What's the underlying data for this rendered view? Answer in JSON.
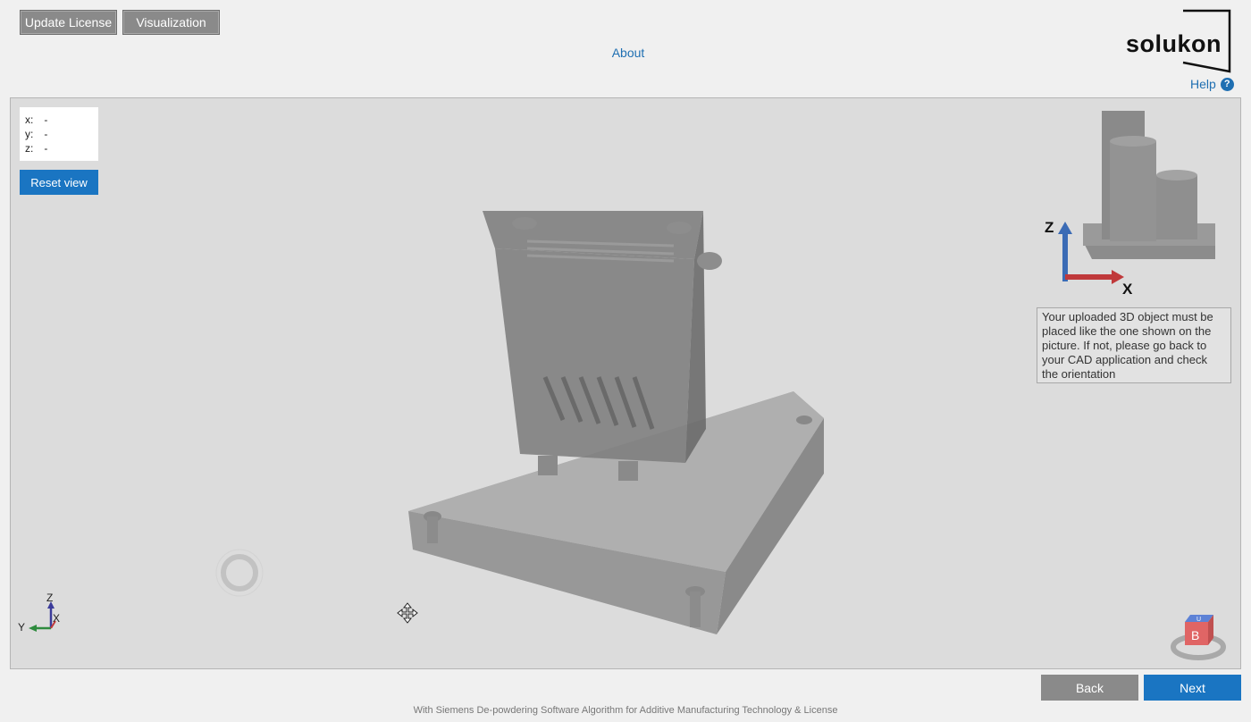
{
  "toolbar": {
    "update_license_label": "Update License",
    "visualization_label": "Visualization",
    "about_label": "About"
  },
  "brand": {
    "logo_text": "solukon",
    "help_label": "Help",
    "help_icon": "?"
  },
  "viewer": {
    "coords": {
      "x_label": "x:",
      "x_value": "-",
      "y_label": "y:",
      "y_value": "-",
      "z_label": "z:",
      "z_value": "-"
    },
    "reset_view_label": "Reset view",
    "reference_axis_z": "Z",
    "reference_axis_x": "X",
    "orientation_info": "Your uploaded 3D object must be placed like the one shown on the picture. If not, please go back to your CAD application and check the orientation",
    "triad_z": "Z",
    "triad_y": "Y",
    "triad_x": "X",
    "view_cube_label": "B",
    "view_cube_top_label": "U"
  },
  "footer": {
    "back_label": "Back",
    "next_label": "Next",
    "credit_text": "With Siemens De-powdering Software Algorithm for Additive Manufacturing Technology & License"
  },
  "colors": {
    "primary_blue": "#1a75c2",
    "button_gray": "#8a8a8a",
    "link_blue": "#1f6fb2",
    "viewport_bg": "#dcdcdc",
    "axis_z_blue": "#3b6bb5",
    "axis_x_red": "#c0393b"
  }
}
